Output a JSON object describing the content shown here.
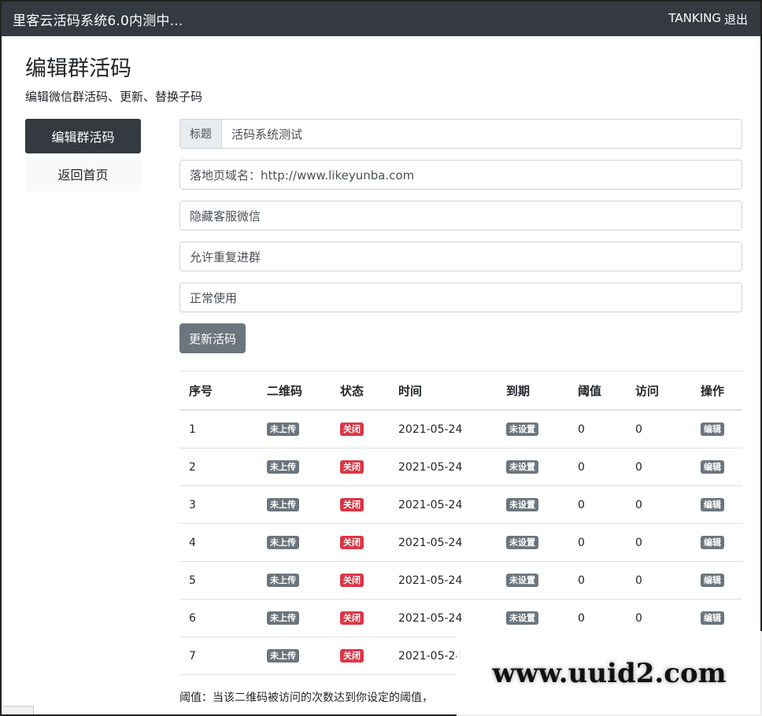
{
  "navbar": {
    "brand": "里客云活码系统6.0内测中...",
    "user": "TANKING",
    "logout": "退出"
  },
  "header": {
    "title": "编辑群活码",
    "subtitle": "编辑微信群活码、更新、替换子码"
  },
  "sidebar": {
    "items": [
      {
        "label": "编辑群活码",
        "active": true
      },
      {
        "label": "返回首页",
        "active": false
      }
    ]
  },
  "form": {
    "title_addon": "标题",
    "title_value": "活码系统测试",
    "domain_value": "落地页域名：http://www.likeyunba.com",
    "kefu_value": "隐藏客服微信",
    "repeat_value": "允许重复进群",
    "status_value": "正常使用",
    "update_button": "更新活码"
  },
  "table": {
    "headers": [
      "序号",
      "二维码",
      "状态",
      "时间",
      "到期",
      "阈值",
      "访问",
      "操作"
    ],
    "rows": [
      {
        "no": "1",
        "qr": "未上传",
        "status": "关闭",
        "time": "2021-05-24",
        "expire": "未设置",
        "threshold": "0",
        "visits": "0",
        "action": "编辑"
      },
      {
        "no": "2",
        "qr": "未上传",
        "status": "关闭",
        "time": "2021-05-24",
        "expire": "未设置",
        "threshold": "0",
        "visits": "0",
        "action": "编辑"
      },
      {
        "no": "3",
        "qr": "未上传",
        "status": "关闭",
        "time": "2021-05-24",
        "expire": "未设置",
        "threshold": "0",
        "visits": "0",
        "action": "编辑"
      },
      {
        "no": "4",
        "qr": "未上传",
        "status": "关闭",
        "time": "2021-05-24",
        "expire": "未设置",
        "threshold": "0",
        "visits": "0",
        "action": "编辑"
      },
      {
        "no": "5",
        "qr": "未上传",
        "status": "关闭",
        "time": "2021-05-24",
        "expire": "未设置",
        "threshold": "0",
        "visits": "0",
        "action": "编辑"
      },
      {
        "no": "6",
        "qr": "未上传",
        "status": "关闭",
        "time": "2021-05-24",
        "expire": "未设置",
        "threshold": "0",
        "visits": "0",
        "action": "编辑"
      },
      {
        "no": "7",
        "qr": "未上传",
        "status": "关闭",
        "time": "2021-05-24",
        "expire": "",
        "threshold": "",
        "visits": "",
        "action": ""
      }
    ]
  },
  "note": "阈值：当该二维码被访问的次数达到你设定的阈值，",
  "watermark": "www.uuid2.com",
  "colors": {
    "navbar": "#343a40",
    "badge_gray": "#6c757d",
    "badge_red": "#dc3545"
  }
}
